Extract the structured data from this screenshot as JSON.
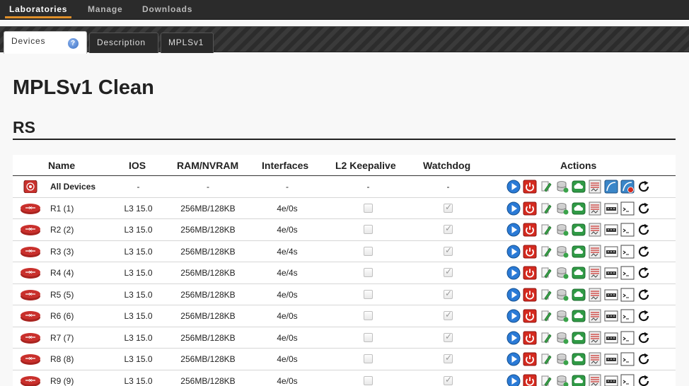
{
  "topnav": {
    "items": [
      {
        "label": "Laboratories",
        "active": true
      },
      {
        "label": "Manage",
        "active": false
      },
      {
        "label": "Downloads",
        "active": false
      }
    ]
  },
  "tabs": [
    {
      "label": "Devices",
      "active": true
    },
    {
      "label": "Description",
      "active": false
    },
    {
      "label": "MPLSv1",
      "active": false
    }
  ],
  "help_icon": "help-icon",
  "page_title": "MPLSv1 Clean",
  "section_title": "RS",
  "table": {
    "headers": [
      "Name",
      "IOS",
      "RAM/NVRAM",
      "Interfaces",
      "L2 Keepalive",
      "Watchdog",
      "Actions"
    ],
    "all_row": {
      "name": "All Devices",
      "ios": "-",
      "ram": "-",
      "interfaces": "-",
      "keepalive": "-",
      "watchdog": "-"
    },
    "rows": [
      {
        "name": "R1 (1)",
        "ios": "L3 15.0",
        "ram": "256MB/128KB",
        "interfaces": "4e/0s",
        "keepalive": false,
        "watchdog": true
      },
      {
        "name": "R2 (2)",
        "ios": "L3 15.0",
        "ram": "256MB/128KB",
        "interfaces": "4e/0s",
        "keepalive": false,
        "watchdog": true
      },
      {
        "name": "R3 (3)",
        "ios": "L3 15.0",
        "ram": "256MB/128KB",
        "interfaces": "4e/4s",
        "keepalive": false,
        "watchdog": true
      },
      {
        "name": "R4 (4)",
        "ios": "L3 15.0",
        "ram": "256MB/128KB",
        "interfaces": "4e/4s",
        "keepalive": false,
        "watchdog": true
      },
      {
        "name": "R5 (5)",
        "ios": "L3 15.0",
        "ram": "256MB/128KB",
        "interfaces": "4e/0s",
        "keepalive": false,
        "watchdog": true
      },
      {
        "name": "R6 (6)",
        "ios": "L3 15.0",
        "ram": "256MB/128KB",
        "interfaces": "4e/0s",
        "keepalive": false,
        "watchdog": true
      },
      {
        "name": "R7 (7)",
        "ios": "L3 15.0",
        "ram": "256MB/128KB",
        "interfaces": "4e/0s",
        "keepalive": false,
        "watchdog": true
      },
      {
        "name": "R8 (8)",
        "ios": "L3 15.0",
        "ram": "256MB/128KB",
        "interfaces": "4e/0s",
        "keepalive": false,
        "watchdog": true
      },
      {
        "name": "R9 (9)",
        "ios": "L3 15.0",
        "ram": "256MB/128KB",
        "interfaces": "4e/0s",
        "keepalive": false,
        "watchdog": true
      }
    ],
    "row_actions": [
      "start-icon",
      "stop-icon",
      "edit-icon",
      "database-icon",
      "cloud-icon",
      "capture-icon",
      "config-icon",
      "console-icon",
      "reload-icon"
    ],
    "all_actions": [
      "start-icon",
      "stop-icon",
      "edit-icon",
      "database-icon",
      "cloud-icon",
      "capture-icon",
      "graph-icon",
      "graph-stop-icon",
      "reload-icon"
    ]
  },
  "colors": {
    "nav_bg": "#2b2b2b",
    "nav_accent": "#e0902a",
    "start": "#2a7ad6",
    "stop": "#d42a1f",
    "cloud": "#2f9a45",
    "router": "#c9302c"
  }
}
